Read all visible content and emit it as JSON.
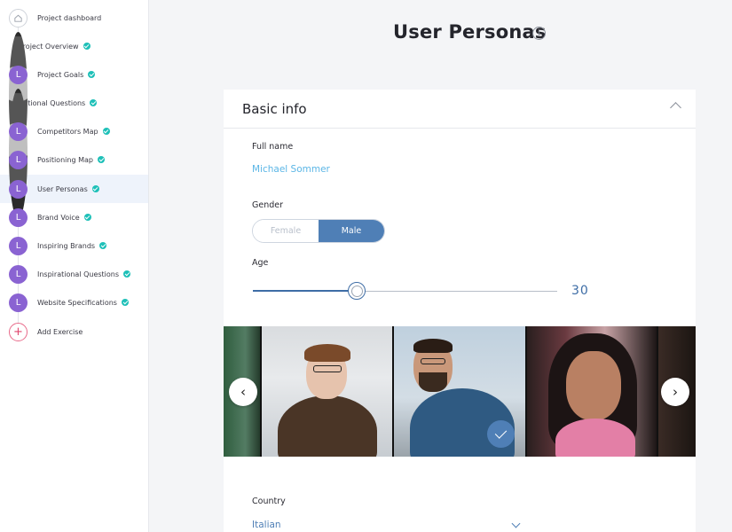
{
  "sidebar": {
    "items": [
      {
        "label": "Project dashboard",
        "avatar": "home-icon",
        "letter": "",
        "done": false,
        "active": false
      },
      {
        "label": "Project Overview",
        "avatar": "photo",
        "letter": "",
        "done": true,
        "active": false
      },
      {
        "label": "Project Goals",
        "avatar": "letter",
        "letter": "L",
        "done": true,
        "active": false
      },
      {
        "label": "Rational Questions",
        "avatar": "photo",
        "letter": "",
        "done": true,
        "active": false
      },
      {
        "label": "Competitors Map",
        "avatar": "letter",
        "letter": "L",
        "done": true,
        "active": false
      },
      {
        "label": "Positioning Map",
        "avatar": "letter",
        "letter": "L",
        "done": true,
        "active": false
      },
      {
        "label": "User Personas",
        "avatar": "letter",
        "letter": "L",
        "done": true,
        "active": true
      },
      {
        "label": "Brand Voice",
        "avatar": "letter",
        "letter": "L",
        "done": true,
        "active": false
      },
      {
        "label": "Inspiring Brands",
        "avatar": "letter",
        "letter": "L",
        "done": true,
        "active": false
      },
      {
        "label": "Inspirational Questions",
        "avatar": "letter",
        "letter": "L",
        "done": true,
        "active": false
      },
      {
        "label": "Website Specifications",
        "avatar": "letter",
        "letter": "L",
        "done": true,
        "active": false
      },
      {
        "label": "Add Exercise",
        "avatar": "add",
        "letter": "+",
        "done": false,
        "active": false
      }
    ]
  },
  "header": {
    "title": "User Personas",
    "info_icon": "info-icon",
    "info_glyph": "i"
  },
  "basic_info": {
    "title": "Basic info",
    "full_name_label": "Full name",
    "full_name_value": "Michael Sommer",
    "gender_label": "Gender",
    "gender_options": [
      "Female",
      "Male"
    ],
    "gender_selected": "Male",
    "age_label": "Age",
    "age_value": "30",
    "age_level_fraction": 0.34,
    "country_label": "Country",
    "country_value": "Italian"
  },
  "carousel": {
    "prev_glyph": "‹",
    "next_glyph": "›",
    "selected_index": 2
  },
  "colors": {
    "accent": "#4f7fb6",
    "check": "#1ec0b8",
    "avatar_letter": "#8a63d2",
    "link": "#5bb6e6"
  }
}
